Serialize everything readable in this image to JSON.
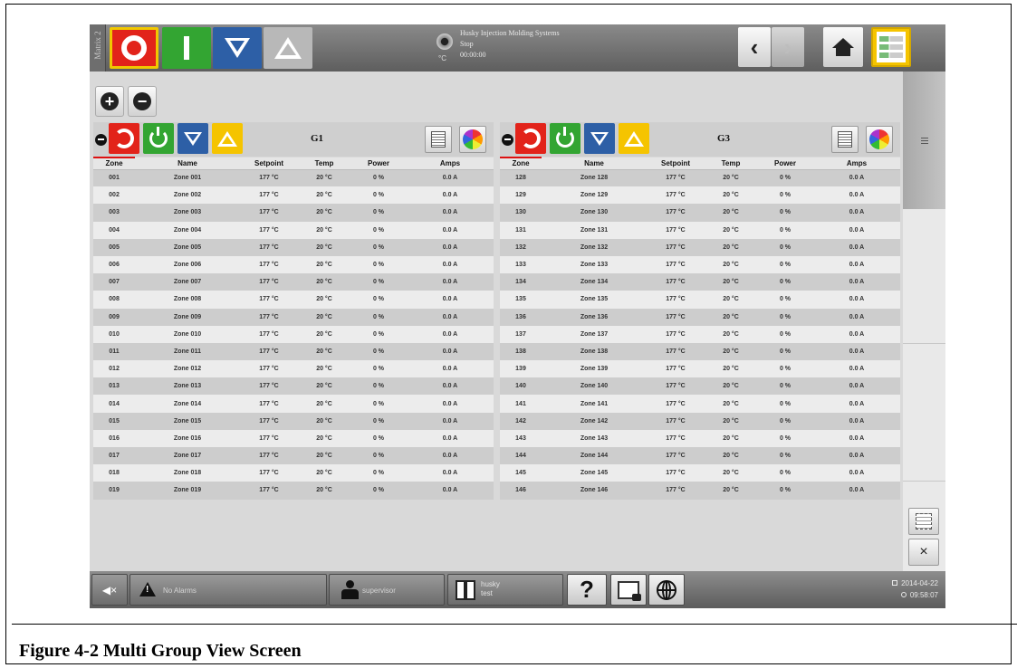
{
  "topbar": {
    "matrix_tab": "Matrix 2",
    "system_name": "Husky Injection Molding Systems",
    "system_state": "Stop",
    "timer": "00:00:00",
    "temp_unit": "°C",
    "buttons": [
      "stop-mode",
      "run-mode",
      "standby-mode",
      "boost-mode"
    ]
  },
  "groups": [
    {
      "name": "G1",
      "columns": [
        "Zone",
        "Name",
        "Setpoint",
        "Temp",
        "Power",
        "Amps"
      ],
      "rows": [
        [
          "001",
          "Zone 001",
          "177 °C",
          "20 °C",
          "0 %",
          "0.0 A"
        ],
        [
          "002",
          "Zone 002",
          "177 °C",
          "20 °C",
          "0 %",
          "0.0 A"
        ],
        [
          "003",
          "Zone 003",
          "177 °C",
          "20 °C",
          "0 %",
          "0.0 A"
        ],
        [
          "004",
          "Zone 004",
          "177 °C",
          "20 °C",
          "0 %",
          "0.0 A"
        ],
        [
          "005",
          "Zone 005",
          "177 °C",
          "20 °C",
          "0 %",
          "0.0 A"
        ],
        [
          "006",
          "Zone 006",
          "177 °C",
          "20 °C",
          "0 %",
          "0.0 A"
        ],
        [
          "007",
          "Zone 007",
          "177 °C",
          "20 °C",
          "0 %",
          "0.0 A"
        ],
        [
          "008",
          "Zone 008",
          "177 °C",
          "20 °C",
          "0 %",
          "0.0 A"
        ],
        [
          "009",
          "Zone 009",
          "177 °C",
          "20 °C",
          "0 %",
          "0.0 A"
        ],
        [
          "010",
          "Zone 010",
          "177 °C",
          "20 °C",
          "0 %",
          "0.0 A"
        ],
        [
          "011",
          "Zone 011",
          "177 °C",
          "20 °C",
          "0 %",
          "0.0 A"
        ],
        [
          "012",
          "Zone 012",
          "177 °C",
          "20 °C",
          "0 %",
          "0.0 A"
        ],
        [
          "013",
          "Zone 013",
          "177 °C",
          "20 °C",
          "0 %",
          "0.0 A"
        ],
        [
          "014",
          "Zone 014",
          "177 °C",
          "20 °C",
          "0 %",
          "0.0 A"
        ],
        [
          "015",
          "Zone 015",
          "177 °C",
          "20 °C",
          "0 %",
          "0.0 A"
        ],
        [
          "016",
          "Zone 016",
          "177 °C",
          "20 °C",
          "0 %",
          "0.0 A"
        ],
        [
          "017",
          "Zone 017",
          "177 °C",
          "20 °C",
          "0 %",
          "0.0 A"
        ],
        [
          "018",
          "Zone 018",
          "177 °C",
          "20 °C",
          "0 %",
          "0.0 A"
        ],
        [
          "019",
          "Zone 019",
          "177 °C",
          "20 °C",
          "0 %",
          "0.0 A"
        ]
      ]
    },
    {
      "name": "G3",
      "columns": [
        "Zone",
        "Name",
        "Setpoint",
        "Temp",
        "Power",
        "Amps"
      ],
      "rows": [
        [
          "128",
          "Zone 128",
          "177 °C",
          "20 °C",
          "0 %",
          "0.0 A"
        ],
        [
          "129",
          "Zone 129",
          "177 °C",
          "20 °C",
          "0 %",
          "0.0 A"
        ],
        [
          "130",
          "Zone 130",
          "177 °C",
          "20 °C",
          "0 %",
          "0.0 A"
        ],
        [
          "131",
          "Zone 131",
          "177 °C",
          "20 °C",
          "0 %",
          "0.0 A"
        ],
        [
          "132",
          "Zone 132",
          "177 °C",
          "20 °C",
          "0 %",
          "0.0 A"
        ],
        [
          "133",
          "Zone 133",
          "177 °C",
          "20 °C",
          "0 %",
          "0.0 A"
        ],
        [
          "134",
          "Zone 134",
          "177 °C",
          "20 °C",
          "0 %",
          "0.0 A"
        ],
        [
          "135",
          "Zone 135",
          "177 °C",
          "20 °C",
          "0 %",
          "0.0 A"
        ],
        [
          "136",
          "Zone 136",
          "177 °C",
          "20 °C",
          "0 %",
          "0.0 A"
        ],
        [
          "137",
          "Zone 137",
          "177 °C",
          "20 °C",
          "0 %",
          "0.0 A"
        ],
        [
          "138",
          "Zone 138",
          "177 °C",
          "20 °C",
          "0 %",
          "0.0 A"
        ],
        [
          "139",
          "Zone 139",
          "177 °C",
          "20 °C",
          "0 %",
          "0.0 A"
        ],
        [
          "140",
          "Zone 140",
          "177 °C",
          "20 °C",
          "0 %",
          "0.0 A"
        ],
        [
          "141",
          "Zone 141",
          "177 °C",
          "20 °C",
          "0 %",
          "0.0 A"
        ],
        [
          "142",
          "Zone 142",
          "177 °C",
          "20 °C",
          "0 %",
          "0.0 A"
        ],
        [
          "143",
          "Zone 143",
          "177 °C",
          "20 °C",
          "0 %",
          "0.0 A"
        ],
        [
          "144",
          "Zone 144",
          "177 °C",
          "20 °C",
          "0 %",
          "0.0 A"
        ],
        [
          "145",
          "Zone 145",
          "177 °C",
          "20 °C",
          "0 %",
          "0.0 A"
        ],
        [
          "146",
          "Zone 146",
          "177 °C",
          "20 °C",
          "0 %",
          "0.0 A"
        ]
      ]
    }
  ],
  "bottombar": {
    "alarms": "No Alarms",
    "user": "supervisor",
    "machine_line1": "husky",
    "machine_line2": "test",
    "help": "?",
    "date": "2014-04-22",
    "time": "09:58:07"
  },
  "caption": "Figure 4-2   Multi Group View Screen",
  "colors": {
    "stop": "#e2231a",
    "run": "#33a532",
    "standby": "#2d5fa6",
    "boost": "#f5c400",
    "active_outline": "#f0c800"
  }
}
